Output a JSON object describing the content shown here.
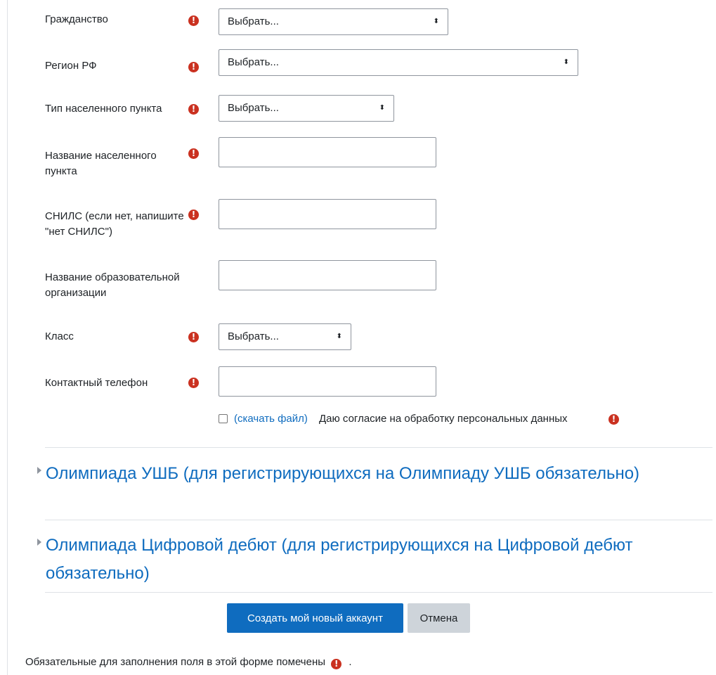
{
  "form": {
    "fields": {
      "citizenship": {
        "label": "Гражданство",
        "value": "Выбрать..."
      },
      "region": {
        "label": "Регион РФ",
        "value": "Выбрать..."
      },
      "settlement_type": {
        "label": "Тип населенного пункта",
        "value": "Выбрать..."
      },
      "settlement_name": {
        "label": "Название населенного пункта",
        "value": ""
      },
      "snils": {
        "label": "СНИЛС (если нет, напишите \"нет СНИЛС\")",
        "value": ""
      },
      "school_name": {
        "label": "Название образовательной организации",
        "value": ""
      },
      "grade": {
        "label": "Класс",
        "value": "Выбрать..."
      },
      "phone": {
        "label": "Контактный телефон",
        "value": ""
      }
    },
    "required_icon": "!",
    "select_arrows": "⬍",
    "consent": {
      "link": "(скачать файл)",
      "text": "Даю согласие на обработку персональных данных",
      "checked": false
    }
  },
  "sections": [
    {
      "title": "Олимпиада УШБ (для регистрирующихся на Олимпиаду УШБ обязательно)"
    },
    {
      "title": "Олимпиада Цифровой дебют (для регистрирующихся на Цифровой дебют обязательно)"
    }
  ],
  "buttons": {
    "submit": "Создать мой новый аккаунт",
    "cancel": "Отмена"
  },
  "footer": {
    "note_before": "Обязательные для заполнения поля в этой форме помечены",
    "note_after": "."
  },
  "colors": {
    "link": "#0f6cbf",
    "required": "#ca3120",
    "primary_button": "#0f6cbf",
    "secondary_button": "#ced4da"
  }
}
